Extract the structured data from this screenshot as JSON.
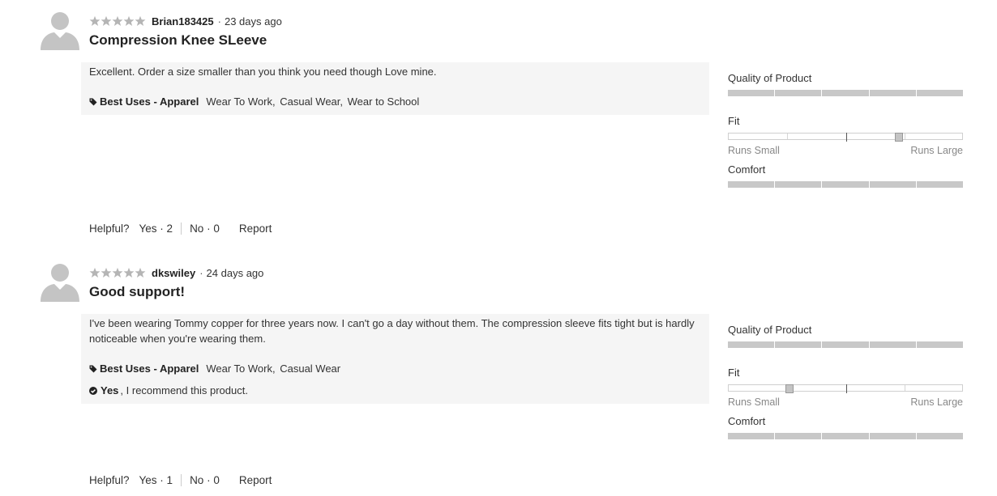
{
  "reviews": [
    {
      "stars": 5,
      "author": "Brian183425",
      "separator": "·",
      "age": "23 days ago",
      "title": "Compression Knee SLeeve",
      "body": "Excellent. Order a size smaller than you think you need though Love mine.",
      "uses_label": "Best Uses - Apparel",
      "uses": [
        "Wear To Work,",
        "Casual Wear,",
        "Wear to School"
      ],
      "recommend": null,
      "ratings": {
        "quality_label": "Quality of Product",
        "quality_fraction": 1.0,
        "fit_label": "Fit",
        "fit_position": 0.73,
        "fit_low": "Runs Small",
        "fit_high": "Runs Large",
        "comfort_label": "Comfort",
        "comfort_fraction": 1.0
      },
      "helpful": {
        "label": "Helpful?",
        "yes": "Yes · 2",
        "no": "No · 0",
        "report": "Report"
      }
    },
    {
      "stars": 5,
      "author": "dkswiley",
      "separator": "·",
      "age": "24 days ago",
      "title": "Good support!",
      "body": "I've been wearing Tommy copper for three years now. I can't go a day without them. The compression sleeve fits tight but is hardly noticeable when you're wearing them.",
      "uses_label": "Best Uses - Apparel",
      "uses": [
        "Wear To Work,",
        "Casual Wear"
      ],
      "recommend": {
        "yes": "Yes",
        "rest": ",  I recommend this product."
      },
      "ratings": {
        "quality_label": "Quality of Product",
        "quality_fraction": 1.0,
        "fit_label": "Fit",
        "fit_position": 0.26,
        "fit_low": "Runs Small",
        "fit_high": "Runs Large",
        "comfort_label": "Comfort",
        "comfort_fraction": 1.0
      },
      "helpful": {
        "label": "Helpful?",
        "yes": "Yes · 1",
        "no": "No · 0",
        "report": "Report"
      }
    }
  ],
  "icons": {
    "avatar": "user-avatar-icon",
    "star": "star-icon",
    "tag": "tag-icon",
    "check": "check-circle-icon"
  },
  "colors": {
    "star": "#b5b5b5",
    "avatar": "#c4c4c4",
    "panel": "#f5f5f5",
    "bar_filled": "#c8c8c8"
  }
}
